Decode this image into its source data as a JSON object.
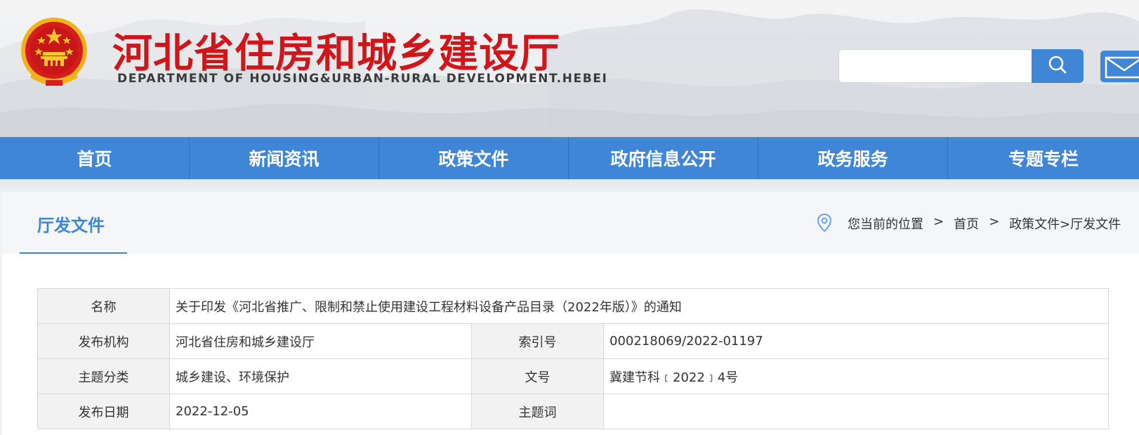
{
  "header": {
    "site_title": "河北省住房和城乡建设厅",
    "site_subtitle": "DEPARTMENT OF HOUSING&URBAN-RURAL DEVELOPMENT.HEBEI",
    "search": {
      "value": "",
      "placeholder": ""
    },
    "search_icon": "search-icon",
    "mail_icon": "mail-icon",
    "colors": {
      "brand_red": "#d0161b",
      "accent_blue": "#3f86d7"
    }
  },
  "nav": {
    "items": [
      {
        "label": "首页"
      },
      {
        "label": "新闻资讯"
      },
      {
        "label": "政策文件"
      },
      {
        "label": "政府信息公开"
      },
      {
        "label": "政务服务"
      },
      {
        "label": "专题专栏"
      }
    ]
  },
  "section": {
    "title": "厅发文件",
    "location_icon": "location-pin-icon",
    "breadcrumb": {
      "prefix": "您当前的位置",
      "sep": ">",
      "home": "首页",
      "path": "政策文件>厅发文件"
    }
  },
  "info": {
    "name_label": "名称",
    "name_value": "关于印发《河北省推广、限制和禁止使用建设工程材料设备产品目录（2022年版）》的通知",
    "publisher_label": "发布机构",
    "publisher_value": "河北省住房和城乡建设厅",
    "index_label": "索引号",
    "index_value": "000218069/2022-01197",
    "category_label": "主题分类",
    "category_value": "城乡建设、环境保护",
    "docno_label": "文号",
    "docno_value": "冀建节科﹝2022﹞4号",
    "date_label": "发布日期",
    "date_value": "2022-12-05",
    "keywords_label": "主题词",
    "keywords_value": ""
  }
}
